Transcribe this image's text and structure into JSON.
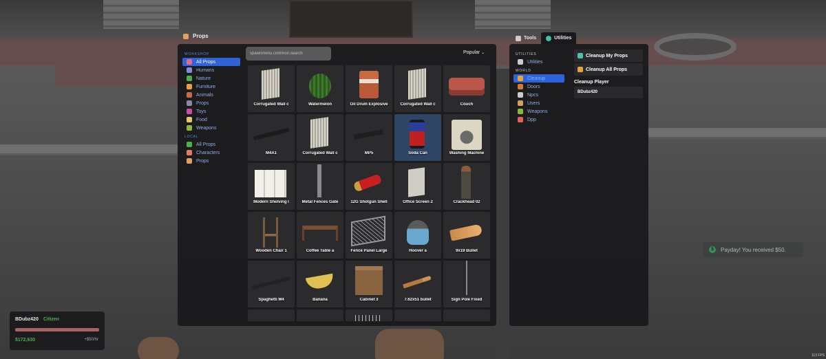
{
  "spawnmenu": {
    "title": "Props",
    "search_placeholder": "spawnmenu.common.search",
    "sort_label": "Popular",
    "sections": [
      {
        "header": "WORKSHOP",
        "items": [
          {
            "label": "All Props",
            "icon": "box-icon",
            "color": "#e06a8a",
            "active": true
          },
          {
            "label": "Humans",
            "icon": "human-icon",
            "color": "#7e8ede"
          },
          {
            "label": "Nature",
            "icon": "leaf-icon",
            "color": "#4caf50"
          },
          {
            "label": "Furniture",
            "icon": "lamp-icon",
            "color": "#e8a040"
          },
          {
            "label": "Animals",
            "icon": "paw-icon",
            "color": "#c86a4a"
          },
          {
            "label": "Props",
            "icon": "bar-icon",
            "color": "#8a8aa8"
          },
          {
            "label": "Toys",
            "icon": "toy-icon",
            "color": "#d048a8"
          },
          {
            "label": "Food",
            "icon": "food-icon",
            "color": "#e8c860"
          },
          {
            "label": "Weapons",
            "icon": "gun-icon",
            "color": "#8ab83a"
          }
        ]
      },
      {
        "header": "LOCAL",
        "items": [
          {
            "label": "All Props",
            "icon": "leaf-icon",
            "color": "#4caf50"
          },
          {
            "label": "Characters",
            "icon": "person-icon",
            "color": "#e07a6a"
          },
          {
            "label": "Props",
            "icon": "crate-icon",
            "color": "#e0a060"
          }
        ]
      }
    ],
    "grid": [
      {
        "label": "Corrugated Wall c",
        "kind": "wall"
      },
      {
        "label": "Watermelon",
        "kind": "melon"
      },
      {
        "label": "Oil Drum Explosive",
        "kind": "drum"
      },
      {
        "label": "Corrugated Wall c",
        "kind": "wall"
      },
      {
        "label": "Couch",
        "kind": "couch"
      },
      {
        "label": "M4A1",
        "kind": "rifle"
      },
      {
        "label": "Corrugated Wall c",
        "kind": "wall"
      },
      {
        "label": "MP5",
        "kind": "smg"
      },
      {
        "label": "Soda Can",
        "kind": "can",
        "selected": true
      },
      {
        "label": "Washing Machine",
        "kind": "washer"
      },
      {
        "label": "Modern Shelving I",
        "kind": "shelf"
      },
      {
        "label": "Metal Fences Gate",
        "kind": "post"
      },
      {
        "label": "12G Shotgun Shell",
        "kind": "shell"
      },
      {
        "label": "Office Screen 2",
        "kind": "screen"
      },
      {
        "label": "Crackhead 02",
        "kind": "person"
      },
      {
        "label": "Wooden Chair 1",
        "kind": "chair"
      },
      {
        "label": "Coffee Table a",
        "kind": "table"
      },
      {
        "label": "Fence Panel Large",
        "kind": "fence"
      },
      {
        "label": "Hoover a",
        "kind": "hoover"
      },
      {
        "label": "9x19 Bullet",
        "kind": "bullet"
      },
      {
        "label": "Spaghetti M4",
        "kind": "shotgun"
      },
      {
        "label": "Banana",
        "kind": "banana"
      },
      {
        "label": "Cabinet 3",
        "kind": "cabinet"
      },
      {
        "label": "7.62x51 bullet",
        "kind": "rifle-bullet"
      },
      {
        "label": "Sign Pole Fixed",
        "kind": "pole"
      },
      {
        "label": "",
        "kind": "blank"
      },
      {
        "label": "",
        "kind": "blank"
      },
      {
        "label": "",
        "kind": "fence-top"
      },
      {
        "label": "",
        "kind": "blank"
      },
      {
        "label": "",
        "kind": "blank"
      }
    ]
  },
  "tools": {
    "tabs": [
      {
        "label": "Tools",
        "icon": "wrench-icon",
        "color": "#cccccc",
        "active": false
      },
      {
        "label": "Utilities",
        "icon": "globe-icon",
        "color": "#40c0a0",
        "active": true
      }
    ],
    "sections": [
      {
        "header": "UTILITIES",
        "items": [
          {
            "label": "Utilities",
            "icon": "wrench-icon",
            "color": "#cccccc"
          }
        ]
      },
      {
        "header": "WORLD",
        "items": [
          {
            "label": "Cleanup",
            "icon": "broom-icon",
            "color": "#e8a040",
            "active": true
          },
          {
            "label": "Doors",
            "icon": "door-icon",
            "color": "#d07a40"
          },
          {
            "label": "Npcs",
            "icon": "npc-icon",
            "color": "#cccccc"
          },
          {
            "label": "Users",
            "icon": "user-icon",
            "color": "#d0a060"
          },
          {
            "label": "Weapons",
            "icon": "gun-icon",
            "color": "#8ab83a"
          },
          {
            "label": "Dpp",
            "icon": "shield-icon",
            "color": "#e06060"
          }
        ]
      }
    ],
    "buttons": [
      {
        "label": "Cleanup My Props",
        "icon": "cleanup-icon",
        "color": "#50c0b0"
      },
      {
        "label": "Cleanup All Props",
        "icon": "broom-icon",
        "color": "#e8a040"
      }
    ],
    "player_label": "Cleanup Player",
    "players": [
      "BDubz420"
    ]
  },
  "hud": {
    "name": "BDubz420",
    "job": "Citizen",
    "health_fraction": 1.0,
    "money": "$172,630",
    "salary": "+$50/hr"
  },
  "notification": {
    "icon": "money-icon",
    "text": "Payday! You received $50."
  },
  "fps": "113 FPS"
}
